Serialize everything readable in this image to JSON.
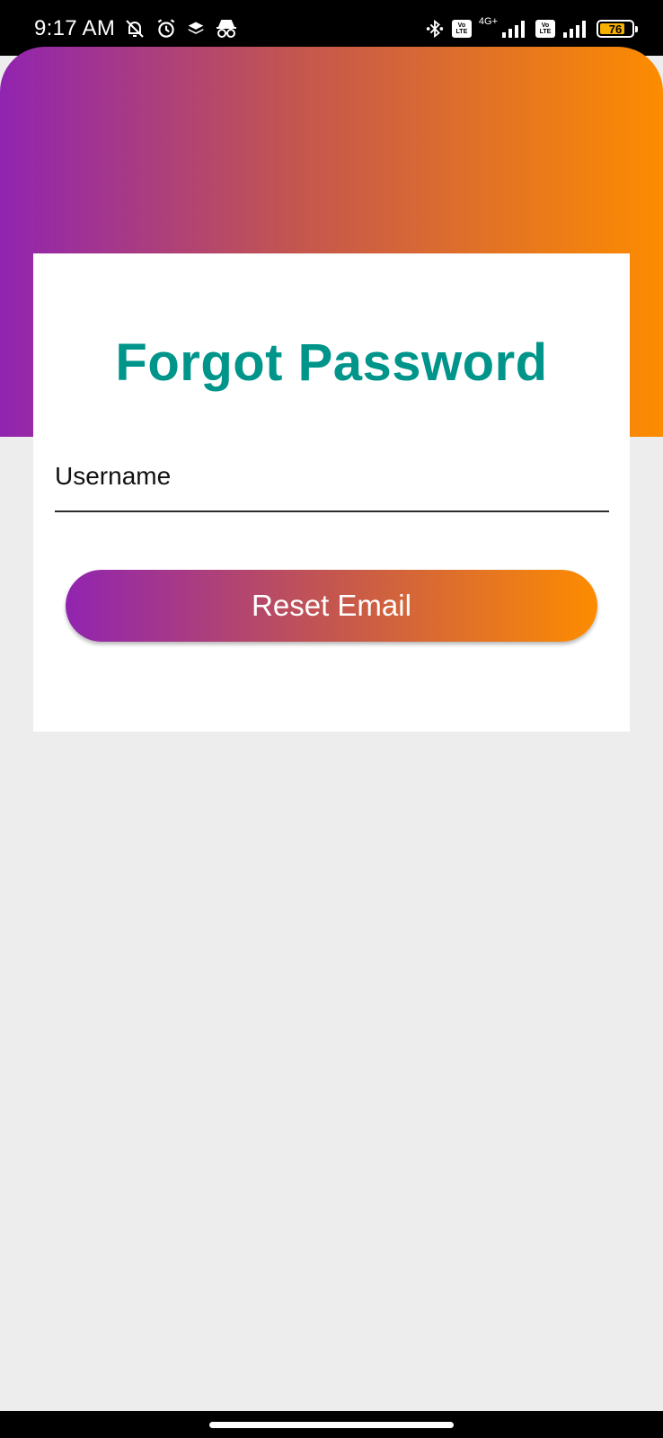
{
  "status_bar": {
    "time": "9:17 AM",
    "icons_left": [
      "bell-off-icon",
      "alarm-icon",
      "layers-icon",
      "incognito-icon"
    ],
    "icons_right": [
      "bluetooth-icon",
      "volte-icon",
      "signal-icon",
      "volte-icon",
      "signal-icon",
      "battery-icon"
    ],
    "volte_label_top": "Vo",
    "volte_label_bottom": "LTE",
    "network_type": "4G+",
    "battery_level": "76"
  },
  "header": {
    "gradient_colors": [
      "#9124b0",
      "#c4564f",
      "#fd8c00"
    ]
  },
  "card": {
    "title": "Forgot Password",
    "title_color": "#00958a",
    "username": {
      "label": "Username",
      "value": ""
    },
    "reset_button_label": "Reset Email"
  }
}
